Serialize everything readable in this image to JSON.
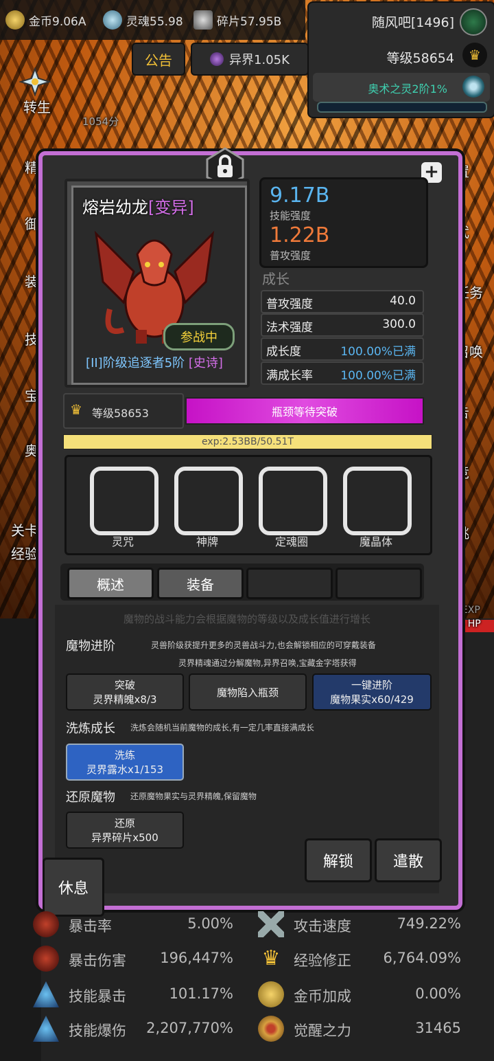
{
  "resources": {
    "gold": "金币9.06A",
    "soul": "灵魂55.98",
    "fragment": "碎片57.95B"
  },
  "buttons": {
    "notice": "公告",
    "otherworld": "异界1.05K"
  },
  "player": {
    "name": "随风吧[1496]",
    "level": "等级58654",
    "spirit": "奥术之灵2阶1%"
  },
  "side_labels": {
    "zhuansheng": "转生",
    "score": "1054分",
    "jing": "精",
    "yu": "御",
    "zhuang": "装",
    "ji": "技",
    "bao": "宝",
    "ao": "奥",
    "guanka": "关卡",
    "jingyan": "经验",
    "zhi": "置",
    "wu": "武",
    "renwu": "任务",
    "zhaohuan": "召唤",
    "gao": "告",
    "jing2": "竞",
    "tiao": "挑",
    "exp_edge": "6EXP",
    "hp_edge": "% HP"
  },
  "monster": {
    "name": "熔岩幼龙",
    "variant": "[变异]",
    "status": "参战中",
    "tier": "[II]阶级追逐者5阶",
    "rarity": "[史诗]",
    "skill_power_value": "9.17B",
    "skill_power_label": "技能强度",
    "attack_power_value": "1.22B",
    "attack_power_label": "普攻强度",
    "growth_title": "成长",
    "growth": [
      {
        "key": "普攻强度",
        "value": "40.0"
      },
      {
        "key": "法术强度",
        "value": "300.0"
      },
      {
        "key": "成长度",
        "value": "100.00%已满"
      },
      {
        "key": "满成长率",
        "value": "100.00%已满"
      }
    ],
    "level": "等级58653",
    "bottleneck": "瓶颈等待突破",
    "exp": "exp:2.53BB/50.51T"
  },
  "slots": [
    "灵咒",
    "神牌",
    "定魂圈",
    "魔晶体"
  ],
  "tabs": [
    "概述",
    "装备",
    "",
    ""
  ],
  "hint": "魔物的战斗能力会根据魔物的等级以及成长值进行增长",
  "sections": {
    "advance_title": "魔物进阶",
    "advance_desc1": "灵兽阶级获提升更多的灵兽战斗力,也会解锁相应的可穿戴装备",
    "advance_desc2": "灵界精魂通过分解魔物,异界召唤,宝藏金字塔获得",
    "breakthrough_l1": "突破",
    "breakthrough_l2": "灵界精魄x8/3",
    "trap": "魔物陷入瓶颈",
    "onekey_l1": "一键进阶",
    "onekey_l2": "魔物果实x60/429",
    "refine_title": "洗炼成长",
    "refine_desc": "洗炼会随机当前魔物的成长,有一定几率直接满成长",
    "refine_l1": "洗练",
    "refine_l2": "灵界露水x1/153",
    "restore_title": "还原魔物",
    "restore_desc": "还原魔物果实与灵界精魄,保留魔物",
    "restore_l1": "还原",
    "restore_l2": "异界碎片x500"
  },
  "actions": {
    "unlock": "解锁",
    "dismiss": "遣散",
    "rest": "休息"
  },
  "stats": [
    {
      "key": "暴击率",
      "value": "5.00%",
      "icon": "crit-rate-icon"
    },
    {
      "key": "攻击速度",
      "value": "749.22%",
      "icon": "attack-speed-icon"
    },
    {
      "key": "暴击伤害",
      "value": "196,447%",
      "icon": "crit-damage-icon"
    },
    {
      "key": "经验修正",
      "value": "6,764.09%",
      "icon": "crown-icon"
    },
    {
      "key": "技能暴击",
      "value": "101.17%",
      "icon": "skill-crit-icon"
    },
    {
      "key": "金币加成",
      "value": "0.00%",
      "icon": "coin-icon"
    },
    {
      "key": "技能爆伤",
      "value": "2,207,770%",
      "icon": "skill-burst-icon"
    },
    {
      "key": "觉醒之力",
      "value": "31465",
      "icon": "awaken-icon"
    }
  ],
  "colors": {
    "modal_border": "#c36fd4",
    "bottleneck": "#d72fd7",
    "skill_power": "#5ab5f0",
    "attack_power": "#f07a3a",
    "gold_text": "#f2c037"
  }
}
